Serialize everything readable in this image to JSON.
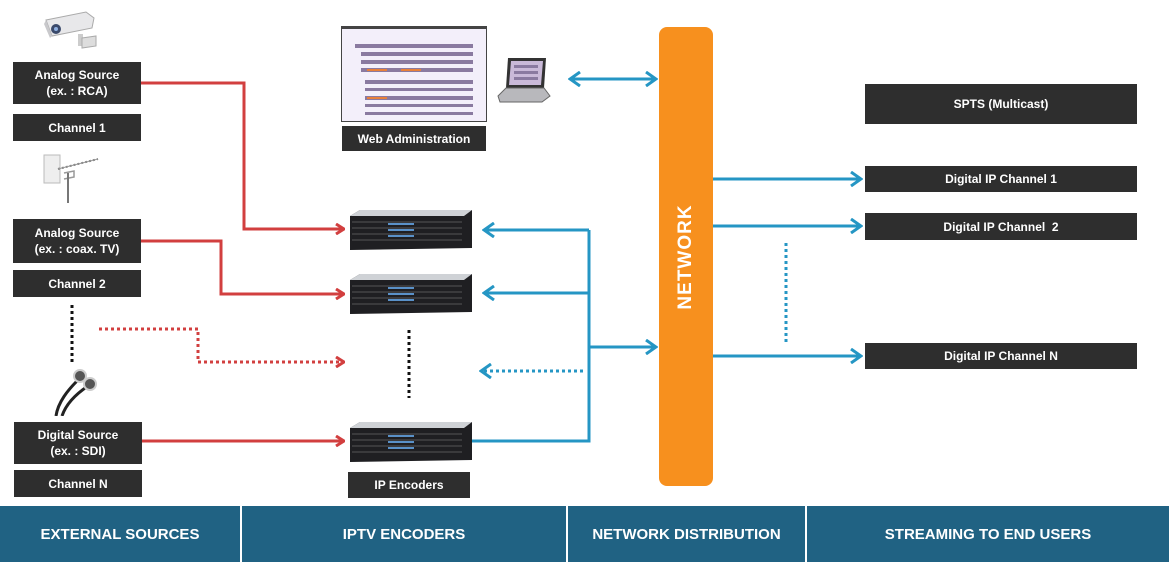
{
  "colors": {
    "source_link": "#d23f3f",
    "network_link": "#2596c4",
    "network_bar": "#f7901e",
    "label_bg": "#2e2e2e",
    "footer_bg": "#206283"
  },
  "sources": [
    {
      "title": "Analog Source",
      "subtitle": "(ex. : RCA)",
      "channel": "Channel 1",
      "icon": "security-camera-icon"
    },
    {
      "title": "Analog Source",
      "subtitle": "(ex. : coax. TV)",
      "channel": "Channel 2",
      "icon": "tv-antenna-icon"
    },
    {
      "title": "Digital Source",
      "subtitle": "(ex. : SDI)",
      "channel": "Channel N",
      "icon": "sdi-cable-icon"
    }
  ],
  "web_admin": {
    "label": "Web Administration"
  },
  "encoders": {
    "label": "IP Encoders",
    "count_shown": 3
  },
  "network": {
    "label": "NETWORK"
  },
  "outputs": {
    "header": "SPTS (Multicast)",
    "channels": [
      "Digital IP Channel 1",
      "Digital IP Channel  2",
      "Digital IP Channel N"
    ]
  },
  "footer": {
    "sections": [
      "EXTERNAL SOURCES",
      "IPTV ENCODERS",
      "NETWORK DISTRIBUTION",
      "STREAMING TO END USERS"
    ]
  }
}
